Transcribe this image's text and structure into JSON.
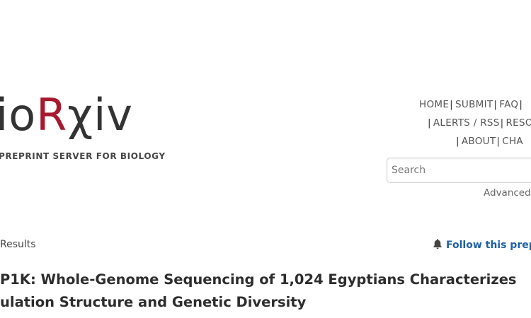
{
  "site": {
    "logo_prefix": "io",
    "logo_r": "R",
    "logo_suffix": "χiv",
    "tagline": "PREPRINT SERVER FOR BIOLOGY"
  },
  "nav": {
    "row1": [
      "HOME",
      "SUBMIT",
      "FAQ"
    ],
    "row2": [
      "ALERTS / RSS",
      "RESO"
    ],
    "row3": [
      "ABOUT",
      "CHA"
    ],
    "separator": "|"
  },
  "search": {
    "placeholder": "Search",
    "value": "",
    "advanced_label": "Advanced"
  },
  "breadcrumb": {
    "label": "Results"
  },
  "follow": {
    "label": "Follow this prep",
    "icon": "bell-icon"
  },
  "article": {
    "title_line1": "P1K: Whole-Genome Sequencing of 1,024 Egyptians Characterizes",
    "title_line2": "ulation Structure and Genetic Diversity"
  },
  "colors": {
    "brand_red": "#a6192e",
    "link_blue": "#1f5fa8",
    "text_dark": "#333333"
  }
}
